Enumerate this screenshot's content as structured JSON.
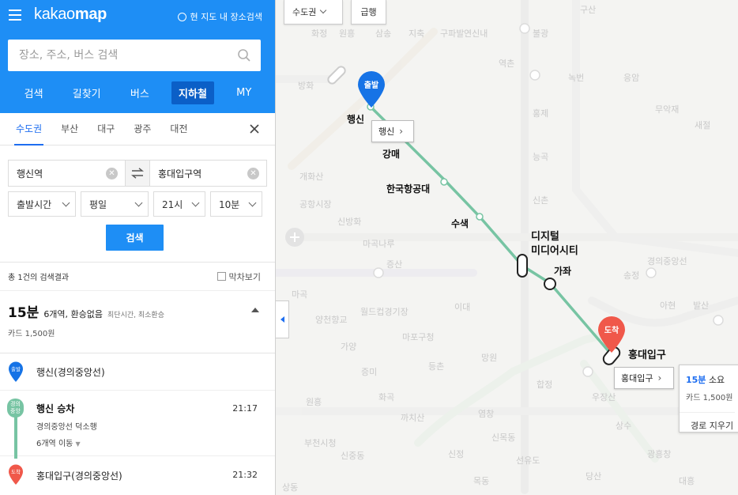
{
  "app": {
    "logo_prefix": "kakao",
    "logo_bold": "map"
  },
  "header": {
    "current_area_search": "현 지도 내 장소검색",
    "search_placeholder": "장소, 주소, 버스 검색",
    "tabs": [
      "검색",
      "길찾기",
      "버스",
      "지하철",
      "MY"
    ],
    "active_tab": "지하철"
  },
  "regions": {
    "items": [
      "수도권",
      "부산",
      "대구",
      "광주",
      "대전"
    ],
    "active": "수도권"
  },
  "route_form": {
    "origin": "행신역",
    "destination": "홍대입구역",
    "depart_option": "출발시간",
    "day_option": "평일",
    "hour_option": "21시",
    "minute_option": "10분",
    "search_button": "검색"
  },
  "results": {
    "count_text": "총 1건의 검색결과",
    "last_train_label": "막차보기"
  },
  "summary": {
    "duration": "15분",
    "description": "6개역, 환승없음",
    "tags": "최단시간, 최소환승",
    "fare": "카드 1,500원"
  },
  "steps": {
    "start": {
      "badge": "출발",
      "station": "행신(경의중앙선)"
    },
    "ride": {
      "line_badge_1": "경의",
      "line_badge_2": "중앙",
      "title": "행신 승차",
      "line": "경의중앙선 덕소행",
      "move": "6개역 이동",
      "time": "21:17"
    },
    "end": {
      "badge": "도착",
      "station": "홍대입구(경의중앙선)",
      "time": "21:32"
    }
  },
  "map": {
    "region_select": "수도권",
    "express_toggle": "급행",
    "start_pin": "출발",
    "end_pin": "도착",
    "stations": {
      "haengsin": "행신",
      "gangmae": "강매",
      "aerospace": "한국항공대",
      "susaek": "수색",
      "dmc_1": "디지털",
      "dmc_2": "미디어시티",
      "gajwa": "가좌",
      "hongdae": "홍대입구"
    },
    "callout_start": "행신",
    "callout_end": "홍대입구",
    "info": {
      "minutes": "15분",
      "minutes_suffix": "소요",
      "fare": "카드 1,500원",
      "clear": "경로 지우기"
    },
    "bg_labels": [
      "화정",
      "원흥",
      "삼송",
      "지축",
      "구파발",
      "연신내",
      "불광",
      "구산",
      "역촌",
      "녹번",
      "응암",
      "홍제",
      "무악재",
      "새절",
      "능곡",
      "방화",
      "개화산",
      "공항시장",
      "신방화",
      "마곡나루",
      "증산",
      "신촌",
      "경의중앙선",
      "송정",
      "마곡",
      "양천향교",
      "월드컵경기장",
      "이대",
      "아현",
      "발산",
      "가양",
      "마포구청",
      "망원",
      "합정",
      "우장산",
      "증미",
      "등촌",
      "원흥",
      "화곡",
      "까치산",
      "염창",
      "신목동",
      "상수",
      "광흥창",
      "부천시청",
      "신중동",
      "신정",
      "선유도",
      "당산",
      "대흥",
      "목동",
      "상동"
    ]
  },
  "colors": {
    "brand_blue": "#1e8ef5",
    "route_line": "#77c4a3",
    "start_pin": "#1673e6",
    "end_pin": "#f0584a"
  }
}
